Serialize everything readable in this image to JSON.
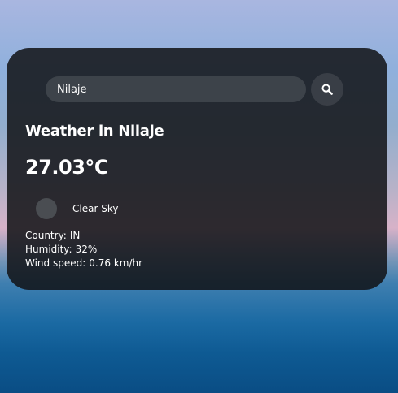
{
  "search": {
    "value": "Nilaje",
    "icon": "search-icon"
  },
  "weather": {
    "title": "Weather in Nilaje",
    "temperature": "27.03°C",
    "condition": "Clear Sky",
    "condition_icon": "weather-icon"
  },
  "details": {
    "country_label": "Country:",
    "country_value": "IN",
    "humidity_label": "Humidity:",
    "humidity_value": "32%",
    "wind_label": "Wind speed:",
    "wind_value": "0.76 km/hr"
  }
}
